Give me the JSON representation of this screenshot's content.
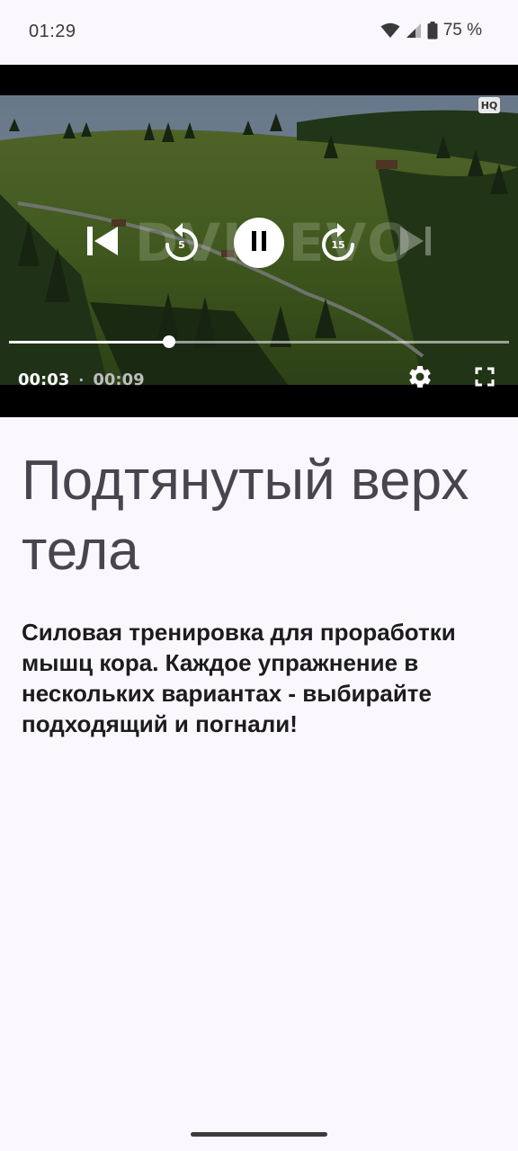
{
  "status_bar": {
    "time": "01:29",
    "battery": "75 %",
    "icons": [
      "wifi-icon",
      "cellular-signal-icon",
      "battery-icon"
    ]
  },
  "player": {
    "hq_badge": "HQ",
    "watermark": "DVIDEVO",
    "rewind_seconds": "5",
    "forward_seconds": "15",
    "current_time": "00:03",
    "separator": "·",
    "duration": "00:09",
    "progress_fraction": 0.32,
    "state": "playing",
    "icons": [
      "skip-previous-icon",
      "replay-5-icon",
      "pause-icon",
      "forward-15-icon",
      "skip-next-icon",
      "settings-gear-icon",
      "fullscreen-icon"
    ]
  },
  "content": {
    "title": "Подтянутый верх тела",
    "description": "Силовая тренировка для проработки мышц кора. Каждое упражнение в нескольких вариантах - выбирайте подходящий и погнали!"
  },
  "colors": {
    "background": "#fbf8fd",
    "title": "#49454f",
    "text": "#1c1b1f"
  }
}
